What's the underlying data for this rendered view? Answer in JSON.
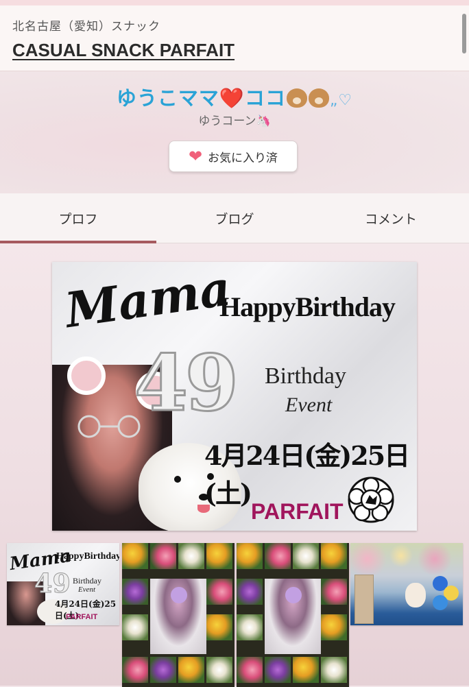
{
  "header": {
    "area": "北名古屋（愛知）スナック",
    "shop_name": "CASUAL SNACK PARFAIT"
  },
  "profile": {
    "name_part1": "ゆうこママ",
    "heart": "❤️",
    "name_part2": "ココ",
    "name_trail": "„♡",
    "subname": "ゆうコーン🦄",
    "favorite_label": "お気に入り済",
    "favorite_icon": "heart-icon"
  },
  "tabs": [
    {
      "label": "プロフ",
      "active": true
    },
    {
      "label": "ブログ",
      "active": false
    },
    {
      "label": "コメント",
      "active": false
    }
  ],
  "poster": {
    "mama": "Mama",
    "happy_birthday": "HappyBirthday",
    "age": "49",
    "birthday": "Birthday",
    "event": "Event",
    "dates": "4月24日(金)25日(土)",
    "brand": "PARFAIT"
  },
  "thumbnails": [
    {
      "kind": "birthday-poster"
    },
    {
      "kind": "flower-collage"
    },
    {
      "kind": "flower-collage"
    },
    {
      "kind": "balloon-photo"
    }
  ],
  "colors": {
    "name": "#2aa3d6",
    "tab_indicator": "#a65a5f",
    "brand": "#a0155c",
    "fav_heart": "#f0607a"
  }
}
